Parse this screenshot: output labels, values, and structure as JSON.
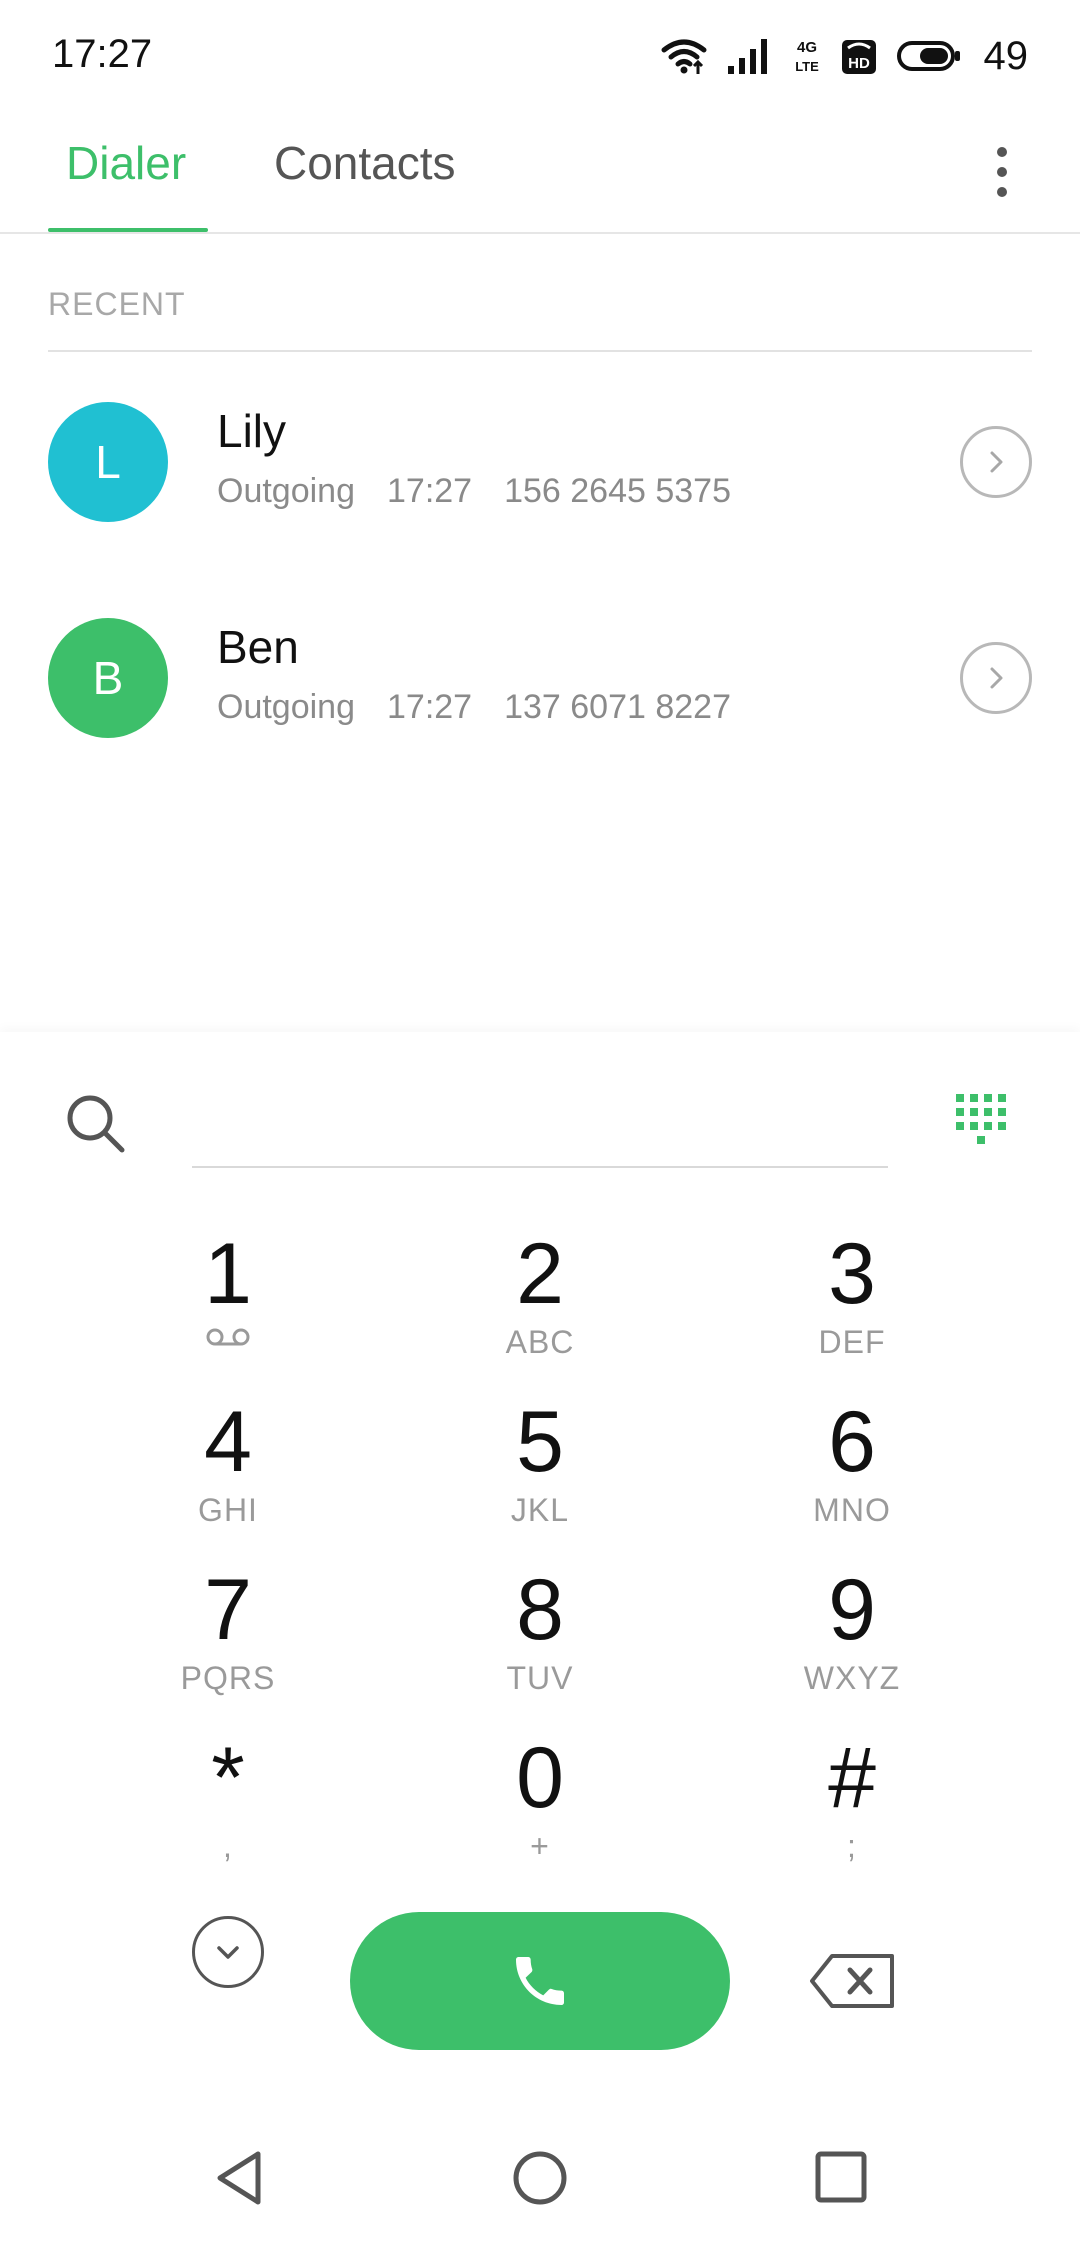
{
  "status_bar": {
    "time": "17:27",
    "battery_percent": "49",
    "icons": [
      "wifi-icon",
      "signal-icon",
      "lte-4g-icon",
      "hd-call-icon",
      "battery-icon"
    ]
  },
  "tabs": {
    "dialer": "Dialer",
    "contacts": "Contacts",
    "active": "Dialer",
    "accent_color": "#3dbf6a"
  },
  "recent": {
    "header": "RECENT",
    "calls": [
      {
        "initial": "L",
        "name": "Lily",
        "type": "Outgoing",
        "time": "17:27",
        "number": "156 2645 5375",
        "avatar_color": "#20c0d2"
      },
      {
        "initial": "B",
        "name": "Ben",
        "type": "Outgoing",
        "time": "17:27",
        "number": "137 6071 8227",
        "avatar_color": "#3dbf6a"
      }
    ]
  },
  "dialer": {
    "input_value": "",
    "keys": [
      {
        "digit": "1",
        "letters": ""
      },
      {
        "digit": "2",
        "letters": "ABC"
      },
      {
        "digit": "3",
        "letters": "DEF"
      },
      {
        "digit": "4",
        "letters": "GHI"
      },
      {
        "digit": "5",
        "letters": "JKL"
      },
      {
        "digit": "6",
        "letters": "MNO"
      },
      {
        "digit": "7",
        "letters": "PQRS"
      },
      {
        "digit": "8",
        "letters": "TUV"
      },
      {
        "digit": "9",
        "letters": "WXYZ"
      },
      {
        "digit": "*",
        "letters": ","
      },
      {
        "digit": "0",
        "letters": "+"
      },
      {
        "digit": "#",
        "letters": ";"
      }
    ],
    "call_button_color": "#3dbf6a"
  }
}
